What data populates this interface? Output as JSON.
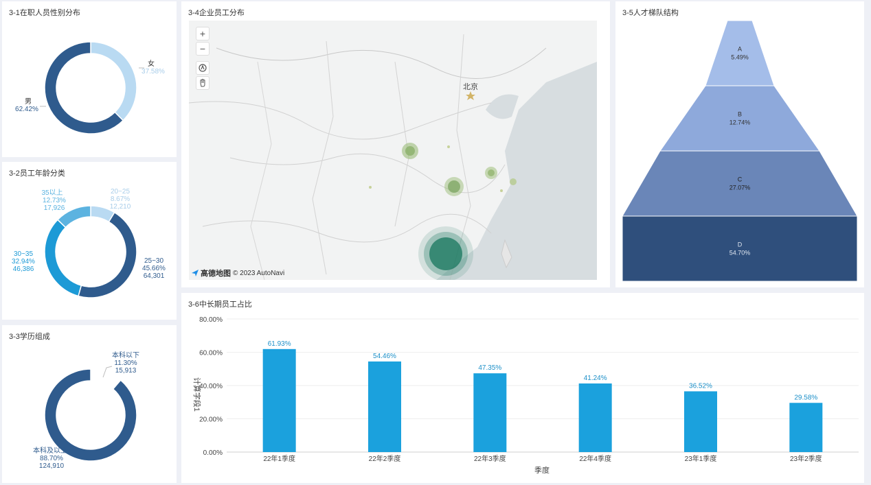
{
  "panels": {
    "gender": {
      "title": "3-1在职人员性别分布",
      "slices": [
        {
          "label": "女",
          "pct": "37.58%",
          "value": 37.58,
          "color": "#b9daf2"
        },
        {
          "label": "男",
          "pct": "62.42%",
          "value": 62.42,
          "color": "#2f5b8d"
        }
      ]
    },
    "age": {
      "title": "3-2员工年龄分类",
      "slices": [
        {
          "label": "20~25",
          "pct": "8.67%",
          "count": "12,210",
          "value": 8.67,
          "color": "#b9daf2"
        },
        {
          "label": "25~30",
          "pct": "45.66%",
          "count": "64,301",
          "value": 45.66,
          "color": "#2f5b8d"
        },
        {
          "label": "30~35",
          "pct": "32.94%",
          "count": "46,386",
          "value": 32.94,
          "color": "#1d9ad6"
        },
        {
          "label": "35以上",
          "pct": "12.73%",
          "count": "17,926",
          "value": 12.73,
          "color": "#5cb3e0"
        }
      ]
    },
    "edu": {
      "title": "3-3学历组成",
      "slices": [
        {
          "label": "本科以下",
          "pct": "11.30%",
          "count": "15,913",
          "value": 11.3,
          "color": "#ffffff"
        },
        {
          "label": "本科及以上",
          "pct": "88.70%",
          "count": "124,910",
          "value": 88.7,
          "color": "#2f5b8d"
        }
      ]
    },
    "map": {
      "title": "3-4企业员工分布",
      "city_label": "北京",
      "zoom_in": "+",
      "zoom_out": "−",
      "logo_brand": "高德地图",
      "copyright": "© 2023 AutoNavi",
      "compass_icon": "compass-icon",
      "hand_icon": "hand-icon"
    },
    "funnel": {
      "title": "3-5人才梯队结构",
      "levels": [
        {
          "label": "A",
          "pct": "5.49%",
          "color": "#a4bde9",
          "text_color": "#333"
        },
        {
          "label": "B",
          "pct": "12.74%",
          "color": "#8ea9db",
          "text_color": "#333"
        },
        {
          "label": "C",
          "pct": "27.07%",
          "color": "#6a86b8",
          "text_color": "#222"
        },
        {
          "label": "D",
          "pct": "54.70%",
          "color": "#2f4f7c",
          "text_color": "#dfe6f0"
        }
      ]
    },
    "bars": {
      "title": "3-6中长期员工占比"
    }
  },
  "chart_data": {
    "type": "bar",
    "categories": [
      "22年1季度",
      "22年2季度",
      "22年3季度",
      "22年4季度",
      "23年1季度",
      "23年2季度"
    ],
    "values": [
      61.93,
      54.46,
      47.35,
      41.24,
      36.52,
      29.58
    ],
    "value_labels": [
      "61.93%",
      "54.46%",
      "47.35%",
      "41.24%",
      "36.52%",
      "29.58%"
    ],
    "yticks": [
      "0.00%",
      "20.00%",
      "40.00%",
      "60.00%",
      "80.00%"
    ],
    "ytick_values": [
      0,
      20,
      40,
      60,
      80
    ],
    "xlabel": "季度",
    "ylabel": "计算字段1",
    "ylim": [
      0,
      80
    ],
    "grid": true,
    "color": "#1ba1dd"
  }
}
